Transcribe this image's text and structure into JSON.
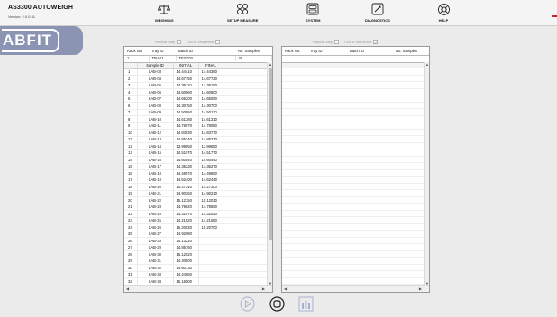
{
  "app": {
    "title": "AS3300 AUTOWEIGH",
    "version": "Version: 2.0.0.31"
  },
  "nav": [
    {
      "label": "WEIGHING",
      "icon": "scale-icon"
    },
    {
      "label": "SETUP MEASURE",
      "icon": "grid-dots-icon"
    },
    {
      "label": "SYSTEM",
      "icon": "system-icon"
    },
    {
      "label": "DIAGNOSTICS",
      "icon": "diagnostics-icon"
    },
    {
      "label": "HELP",
      "icon": "help-lifebuoy-icon"
    }
  ],
  "logo_text": "ABFIT",
  "left_panel": {
    "options": {
      "repeat_step": "Repeat Step",
      "out_of_sequence": "Out of Sequence"
    },
    "header_columns": [
      "Rack No.",
      "Tray ID",
      "Batch ID",
      "No. Samples"
    ],
    "header_row": [
      "1",
      "TRAY1",
      "TEST03",
      "40"
    ],
    "grid_columns": [
      "",
      "Sample ID",
      "INITIAL",
      "FINAL"
    ],
    "rows": [
      [
        "1",
        "LAB-03",
        "14.44410",
        "14.44360"
      ],
      [
        "2",
        "LAB-04",
        "14.67750",
        "14.67720"
      ],
      [
        "3",
        "LAB-05",
        "14.36110",
        "14.36150"
      ],
      [
        "4",
        "LAB-06",
        "14.60560",
        "14.60600"
      ],
      [
        "5",
        "LAB-07",
        "14.65200",
        "14.65090"
      ],
      [
        "6",
        "LAB-08",
        "14.30750",
        "14.30700"
      ],
      [
        "7",
        "LAB-09",
        "14.50050",
        "14.50110"
      ],
      [
        "8",
        "LAB-10",
        "14.61380",
        "14.61310"
      ],
      [
        "9",
        "LAB-11",
        "14.78070",
        "14.78080"
      ],
      [
        "10",
        "LAB-12",
        "14.83630",
        "14.83770"
      ],
      [
        "11",
        "LAB-13",
        "14.85740",
        "14.85710"
      ],
      [
        "12",
        "LAB-14",
        "13.99650",
        "13.99650"
      ],
      [
        "13",
        "LAB-15",
        "14.51970",
        "14.51770"
      ],
      [
        "14",
        "LAB-16",
        "14.60540",
        "14.60490"
      ],
      [
        "15",
        "LAB-17",
        "14.36230",
        "14.36270"
      ],
      [
        "16",
        "LAB-18",
        "14.49570",
        "14.49650"
      ],
      [
        "17",
        "LAB-19",
        "14.62400",
        "14.62440"
      ],
      [
        "18",
        "LAB-20",
        "14.27240",
        "14.27200"
      ],
      [
        "19",
        "LAB-21",
        "14.90250",
        "14.90210"
      ],
      [
        "20",
        "LAB-22",
        "15.12150",
        "15.12010"
      ],
      [
        "21",
        "LAB-23",
        "14.78620",
        "14.78590"
      ],
      [
        "22",
        "LAB-24",
        "14.31970",
        "14.32020"
      ],
      [
        "23",
        "LAB-25",
        "14.21520",
        "14.21550"
      ],
      [
        "24",
        "LAB-26",
        "15.20630",
        "15.20700"
      ],
      [
        "25",
        "LAB-27",
        "14.92080",
        ""
      ],
      [
        "26",
        "LAB-28",
        "14.13220",
        ""
      ],
      [
        "27",
        "LAB-29",
        "14.85760",
        ""
      ],
      [
        "28",
        "LAB-30",
        "15.12520",
        ""
      ],
      [
        "29",
        "LAB-31",
        "14.40800",
        ""
      ],
      [
        "30",
        "LAB-32",
        "14.60730",
        ""
      ],
      [
        "31",
        "LAB-33",
        "14.44660",
        ""
      ],
      [
        "32",
        "LAB-34",
        "15.16000",
        ""
      ]
    ]
  },
  "right_panel": {
    "options": {
      "repeat_step": "Repeat Step",
      "out_of_sequence": "Out of Sequence",
      "out_of_sequence_checked": "✓"
    },
    "header_columns": [
      "Rack No.",
      "Tray ID",
      "Batch ID",
      "No. Samples"
    ]
  },
  "bottom_controls": [
    {
      "name": "play-button",
      "icon": "play-icon"
    },
    {
      "name": "stop-button",
      "icon": "stop-icon"
    },
    {
      "name": "chart-button",
      "icon": "bar-chart-icon"
    }
  ]
}
